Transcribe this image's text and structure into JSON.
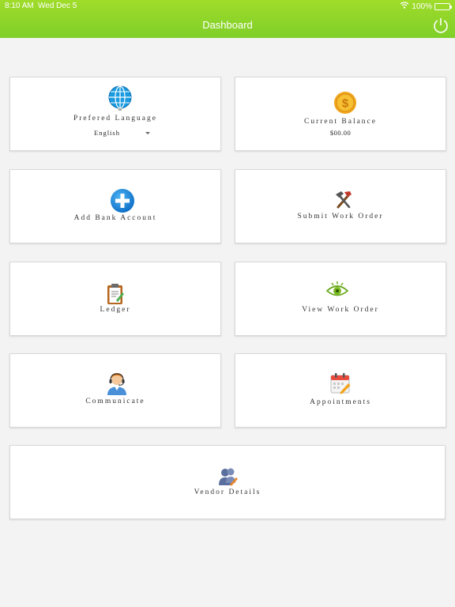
{
  "status_bar": {
    "time": "8:10 AM",
    "date": "Wed Dec 5",
    "battery": "100%",
    "battery_level": 1.0,
    "wifi_icon": "wifi-icon"
  },
  "header": {
    "title": "Dashboard",
    "power_icon": "power-icon",
    "bar_color": "#8fd62a"
  },
  "cards": {
    "language": {
      "label": "Prefered Language",
      "value": "English",
      "icon": "globe-icon"
    },
    "balance": {
      "label": "Current Balance",
      "value": "$00.00",
      "icon": "dollar-coin-icon"
    },
    "add_bank": {
      "label": "Add Bank Account",
      "icon": "plus-circle-icon"
    },
    "submit_work_order": {
      "label": "Submit Work Order",
      "icon": "hammer-icon"
    },
    "ledger": {
      "label": "Ledger",
      "icon": "clipboard-icon"
    },
    "view_work_order": {
      "label": "View Work Order",
      "icon": "eye-icon"
    },
    "communicate": {
      "label": "Communicate",
      "icon": "support-agent-icon"
    },
    "appointments": {
      "label": "Appointments",
      "icon": "calendar-icon"
    },
    "vendor_details": {
      "label": "Vendor Details",
      "icon": "vendor-people-icon"
    }
  }
}
